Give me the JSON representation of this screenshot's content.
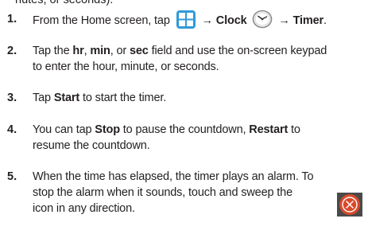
{
  "top_fragment": "nutes, or seconds).",
  "steps": [
    {
      "number": "1.",
      "parts": {
        "a": "From the Home screen, tap",
        "arrow1": "→",
        "clock": "Clock",
        "arrow2": "→",
        "timer": "Timer",
        "end": "."
      }
    },
    {
      "number": "2.",
      "parts": {
        "a": "Tap the ",
        "hr": "hr",
        "sep1": ", ",
        "min": "min",
        "sep2": ", or ",
        "sec": "sec",
        "b": " field and use the on-screen keypad",
        "line2": "to enter the hour, minute, or seconds."
      }
    },
    {
      "number": "3.",
      "parts": {
        "a": "Tap ",
        "start": "Start",
        "b": " to start the timer."
      }
    },
    {
      "number": "4.",
      "parts": {
        "a": "You can tap ",
        "stop": "Stop",
        "b": " to pause the countdown, ",
        "restart": "Restart",
        "c": " to",
        "line2": "resume the countdown."
      }
    },
    {
      "number": "5.",
      "parts": {
        "line1": "When the time has elapsed, the timer plays an alarm. To",
        "line2": "stop the alarm when it sounds, touch and sweep the",
        "line3": "icon in any direction."
      }
    }
  ],
  "icons": {
    "apps": "apps-grid-icon",
    "clock": "clock-icon",
    "stop_alarm": "stop-alarm-icon"
  },
  "colors": {
    "apps_icon_bg": "#2f9ad8",
    "stop_icon_bg": "#d94a2a",
    "stop_icon_dark": "#4a4a4a"
  }
}
